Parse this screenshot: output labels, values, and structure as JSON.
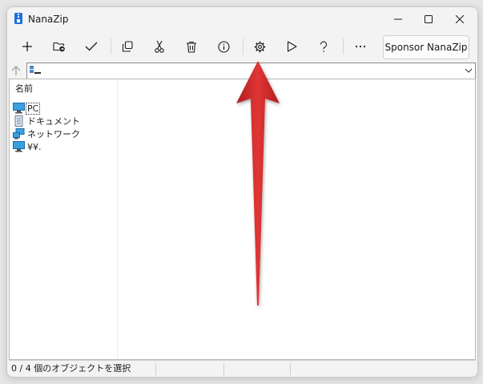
{
  "window": {
    "title": "NanaZip"
  },
  "title_bar_buttons": [
    {
      "name": "minimize-button",
      "icon": "minimize-icon"
    },
    {
      "name": "maximize-button",
      "icon": "maximize-icon"
    },
    {
      "name": "close-button",
      "icon": "close-icon"
    }
  ],
  "toolbar": {
    "buttons": [
      {
        "name": "add-button",
        "icon": "plus-icon"
      },
      {
        "name": "extract-button",
        "icon": "folder-extract-icon"
      },
      {
        "name": "test-button",
        "icon": "checkmark-icon"
      },
      {
        "name": "copy-button",
        "icon": "copy-icon"
      },
      {
        "name": "move-button",
        "icon": "scissors-icon"
      },
      {
        "name": "delete-button",
        "icon": "trash-icon"
      },
      {
        "name": "info-button",
        "icon": "info-icon"
      },
      {
        "name": "settings-button",
        "icon": "gear-icon"
      },
      {
        "name": "run-button",
        "icon": "play-icon"
      },
      {
        "name": "help-button",
        "icon": "question-icon"
      },
      {
        "name": "more-button",
        "icon": "ellipsis-icon"
      }
    ],
    "sponsor_label": "Sponsor NanaZip"
  },
  "address": {
    "value": "",
    "icon": "computer-list-icon"
  },
  "list": {
    "column_header": "名前",
    "items": [
      {
        "label": "PC",
        "icon": "pc-icon",
        "selected": true
      },
      {
        "label": "ドキュメント",
        "icon": "document-icon",
        "selected": false
      },
      {
        "label": "ネットワーク",
        "icon": "network-icon",
        "selected": false
      },
      {
        "label": "¥¥.",
        "icon": "monitor-icon",
        "selected": false
      }
    ]
  },
  "status": {
    "selection_text": "0 / 4 個のオブジェクトを選択",
    "cells": [
      "",
      "",
      ""
    ]
  },
  "colors": {
    "arrow": "#d42a2a",
    "accent": "#1e6fd9"
  }
}
